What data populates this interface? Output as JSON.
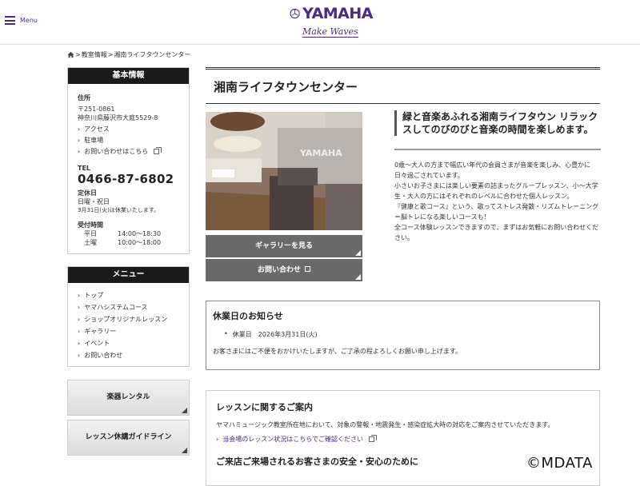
{
  "header": {
    "menu_label": "Menu",
    "logo_word": "YAMAHA",
    "logo_tagline": "Make Waves"
  },
  "breadcrumb": {
    "items": [
      "教室情報",
      "湘南ライフタウンセンター"
    ]
  },
  "sidebar": {
    "basic": {
      "title": "基本情報",
      "address_label": "住所",
      "postal": "〒251-0861",
      "address": "神奈川県藤沢市大庭5529-8",
      "links": [
        "アクセス",
        "駐車場",
        "お問い合わせはこちら"
      ],
      "tel_label": "TEL",
      "tel": "0466-87-6802",
      "holiday_label": "定休日",
      "holiday": "日曜・祝日",
      "holiday_note": "3月31日(火)は休業いたします。",
      "hours_label": "受付時間",
      "hours": [
        {
          "day": "平日",
          "time": "14:00〜18:30"
        },
        {
          "day": "土曜",
          "time": "10:00〜18:00"
        }
      ]
    },
    "menu": {
      "title": "メニュー",
      "items": [
        "トップ",
        "ヤマハシステムコース",
        "ショップオリジナルレッスン",
        "ギャラリー",
        "イベント",
        "お問い合わせ"
      ]
    },
    "buttons": [
      "楽器レンタル",
      "レッスン休講ガイドライン"
    ]
  },
  "main": {
    "title": "湘南ライフタウンセンター",
    "gallery_button": "ギャラリーを見る",
    "contact_button": "お問い合わせ",
    "catch": "緑と音楽あふれる湘南ライフタウン リラックスしてのびのびと音楽の時間を楽しめます。",
    "description": [
      "0歳〜大人の方まで幅広い年代の会員さまが音楽を楽しみ、心豊かに日々過ごされています。",
      "小さいお子さまには楽しい要素の詰まったグループレッスン、小〜大学生・大人の方にはそれぞれのレベルに合わせた個人レッスン。",
      "『健康と歌コース』という、歌ってストレス発散・リズムトレーニング＝脳トレになる楽しいコースも！",
      "全コース体験レッスンできますので、まずはお気軽にお問い合わせください。"
    ],
    "notice": {
      "title": "休業日のお知らせ",
      "item": "休業日　2026年3月31日(火)",
      "text": "お客さまにはご不便をおかけいたしますが、ご了承の程よろしくお願い申し上げます。"
    },
    "lesson": {
      "title": "レッスンに関するご案内",
      "text": "ヤマハミュージック教室所在地において、対象の警報・地震発生・感染症拡大時の対応をご案内させていただきます。",
      "link": "当会場のレッスン状況はこちらでご確認ください",
      "subtitle": "ご来店ご来場されるお客さまの安全・安心のために"
    }
  },
  "footer": {
    "copyright": "©MDATA"
  },
  "colors": {
    "brand": "#4b2a83",
    "dark_header": "#1a1a1a",
    "button_gray": "#6a6a6a"
  }
}
